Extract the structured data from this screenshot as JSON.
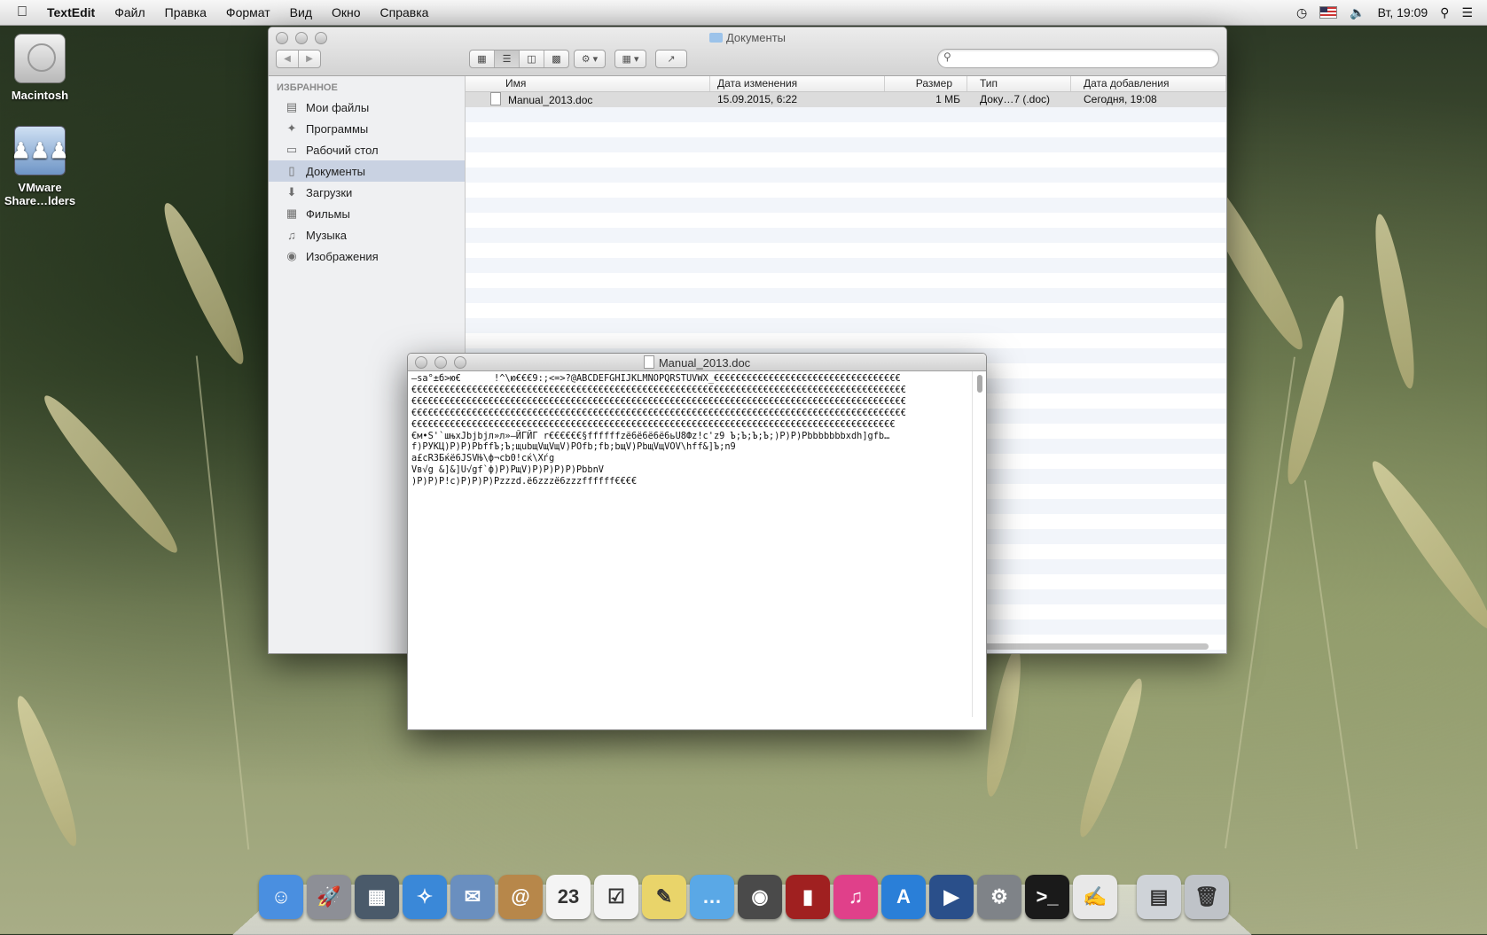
{
  "menubar": {
    "apple_icon": "apple-logo",
    "app_name": "TextEdit",
    "items": [
      "Файл",
      "Правка",
      "Формат",
      "Вид",
      "Окно",
      "Справка"
    ],
    "clock": "Вт, 19:09",
    "status_icons": [
      "time-machine-icon",
      "us-flag-icon",
      "volume-icon",
      "spotlight-icon",
      "list-icon"
    ]
  },
  "desktop": {
    "icons": [
      {
        "label": "Macintosh",
        "icon": "hard-drive-icon"
      },
      {
        "label": "VMware Share…lders",
        "icon": "shared-folder-icon"
      }
    ]
  },
  "finder": {
    "title": "Документы",
    "sidebar": {
      "heading": "ИЗБРАННОЕ",
      "items": [
        {
          "label": "Мои файлы",
          "icon": "all-files-icon",
          "glyph": "▤"
        },
        {
          "label": "Программы",
          "icon": "applications-icon",
          "glyph": "✦"
        },
        {
          "label": "Рабочий стол",
          "icon": "desktop-icon",
          "glyph": "▭"
        },
        {
          "label": "Документы",
          "icon": "documents-icon",
          "glyph": "▯",
          "selected": true
        },
        {
          "label": "Загрузки",
          "icon": "downloads-icon",
          "glyph": "⬇"
        },
        {
          "label": "Фильмы",
          "icon": "movies-icon",
          "glyph": "▦"
        },
        {
          "label": "Музыка",
          "icon": "music-icon",
          "glyph": "♫"
        },
        {
          "label": "Изображения",
          "icon": "pictures-icon",
          "glyph": "◉"
        }
      ]
    },
    "columns": [
      "Имя",
      "Дата изменения",
      "Размер",
      "Тип",
      "Дата добавления"
    ],
    "files": [
      {
        "name": "Manual_2013.doc",
        "modified": "15.09.2015, 6:22",
        "size": "1 МБ",
        "kind": "Доку…7 (.doc)",
        "added": "Сегодня, 19:08"
      }
    ]
  },
  "textedit": {
    "title": "Manual_2013.doc",
    "lines": [
      "—ѕа°±б>ю€      !^\\ю€€€9:;<=>?@ABCDEFGHIJKLMNOPQRSTUVWX_€€€€€€€€€€€€€€€€€€€€€€€€€€€€€€€€€€",
      "€€€€€€€€€€€€€€€€€€€€€€€€€€€€€€€€€€€€€€€€€€€€€€€€€€€€€€€€€€€€€€€€€€€€€€€€€€€€€€€€€€€€€€€€€€",
      "€€€€€€€€€€€€€€€€€€€€€€€€€€€€€€€€€€€€€€€€€€€€€€€€€€€€€€€€€€€€€€€€€€€€€€€€€€€€€€€€€€€€€€€€€€",
      "€€€€€€€€€€€€€€€€€€€€€€€€€€€€€€€€€€€€€€€€€€€€€€€€€€€€€€€€€€€€€€€€€€€€€€€€€€€€€€€€€€€€€€€€€€",
      "€€€€€€€€€€€€€€€€€€€€€€€€€€€€€€€€€€€€€€€€€€€€€€€€€€€€€€€€€€€€€€€€€€€€€€€€€€€€€€€€€€€€€€€€",
      "€м•S'`шњxJbjbjл»л»—ЙГЙГ r€€€€€€§ffffffzё6ё6ё6ё6ьU8Фz!c'z9 Ъ;Ъ;Ъ;Ъ;)P)P)Pbbbbbbbxdh]gfb…",
      "f)PУКЦ)P)P)PbffЪ;Ъ;щubщVщVщV)POfb;fb;bщV)PbщVщVOV\\hff&]Ъ;n9",
      "a£cR3Бќё6JSVЊ\\ф¬cb0!cќ\\Xѓg",
      "Vв√g &]&]U√gf`ф)P)PщV)P)P)P)P)PbbnV",
      ")P)P)P!c)P)P)P)Pzzzd.ё6zzzё6zzzffffff€€€€"
    ]
  },
  "dock": {
    "apps": [
      {
        "name": "Finder",
        "icon": "finder-icon",
        "color": "#4a8fe0",
        "glyph": "☺"
      },
      {
        "name": "Launchpad",
        "icon": "launchpad-icon",
        "color": "#8d8f96",
        "glyph": "🚀"
      },
      {
        "name": "Mission Control",
        "icon": "mission-control-icon",
        "color": "#4a5a6a",
        "glyph": "▦"
      },
      {
        "name": "Safari",
        "icon": "safari-icon",
        "color": "#3a88d8",
        "glyph": "✧"
      },
      {
        "name": "Mail",
        "icon": "mail-icon",
        "color": "#6a8fbf",
        "glyph": "✉"
      },
      {
        "name": "Contacts",
        "icon": "contacts-icon",
        "color": "#b7874a",
        "glyph": "@"
      },
      {
        "name": "Calendar",
        "icon": "calendar-icon",
        "color": "#f4f4f4",
        "glyph": "23"
      },
      {
        "name": "Reminders",
        "icon": "reminders-icon",
        "color": "#f2f2f2",
        "glyph": "☑"
      },
      {
        "name": "Notes",
        "icon": "notes-icon",
        "color": "#e9d46a",
        "glyph": "✎"
      },
      {
        "name": "Messages",
        "icon": "messages-icon",
        "color": "#5aa8e6",
        "glyph": "…"
      },
      {
        "name": "FaceTime",
        "icon": "facetime-icon",
        "color": "#4a4a4a",
        "glyph": "◉"
      },
      {
        "name": "Photo Booth",
        "icon": "photo-booth-icon",
        "color": "#a02020",
        "glyph": "▮"
      },
      {
        "name": "iTunes",
        "icon": "itunes-icon",
        "color": "#e0408a",
        "glyph": "♫"
      },
      {
        "name": "App Store",
        "icon": "app-store-icon",
        "color": "#2a7fd8",
        "glyph": "A"
      },
      {
        "name": "QuickTime Player",
        "icon": "quicktime-icon",
        "color": "#2a4f8a",
        "glyph": "▶"
      },
      {
        "name": "System Preferences",
        "icon": "system-preferences-icon",
        "color": "#7f8388",
        "glyph": "⚙"
      },
      {
        "name": "Terminal",
        "icon": "terminal-icon",
        "color": "#1a1a1a",
        "glyph": ">_"
      },
      {
        "name": "TextEdit",
        "icon": "textedit-icon",
        "color": "#e8e8e8",
        "glyph": "✍"
      }
    ],
    "extras": [
      {
        "name": "Documents stack",
        "icon": "documents-stack-icon",
        "color": "#cfd3d8",
        "glyph": "▤"
      },
      {
        "name": "Trash",
        "icon": "trash-icon",
        "color": "#bfc3c8",
        "glyph": "🗑"
      }
    ]
  }
}
